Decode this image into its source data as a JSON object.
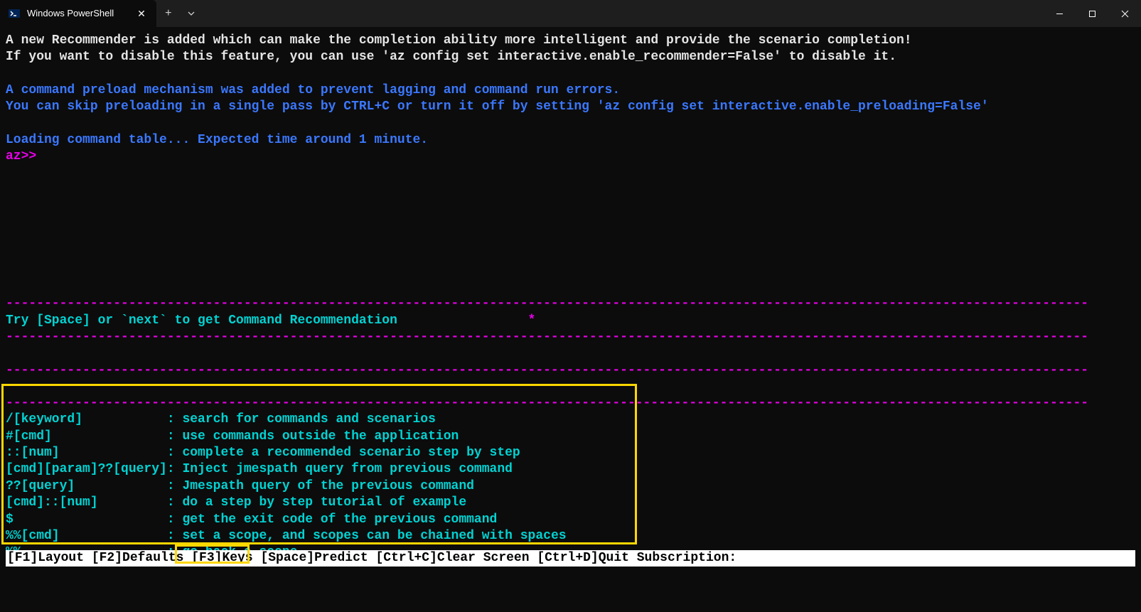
{
  "window": {
    "tab_title": "Windows PowerShell"
  },
  "terminal": {
    "line1": "A new Recommender is added which can make the completion ability more intelligent and provide the scenario completion!",
    "line2": "If you want to disable this feature, you can use 'az config set interactive.enable_recommender=False' to disable it.",
    "line3": "A command preload mechanism was added to prevent lagging and command run errors.",
    "line4": "You can skip preloading in a single pass by CTRL+C or turn it off by setting 'az config set interactive.enable_preloading=False'",
    "line5": "Loading command table... Expected time around 1 minute.",
    "prompt": "az>>",
    "rec_text": "Try [Space] or `next` to get Command Recommendation",
    "asterisk": "*",
    "dashes": "---------------------------------------------------------------------------------------------------------------------------------------------",
    "help_lines": [
      {
        "key": "/[keyword]           ",
        "sep": ": ",
        "desc": "search for commands and scenarios"
      },
      {
        "key": "#[cmd]               ",
        "sep": ": ",
        "desc": "use commands outside the application"
      },
      {
        "key": "::[num]              ",
        "sep": ": ",
        "desc": "complete a recommended scenario step by step"
      },
      {
        "key": "[cmd][param]??[query]",
        "sep": ": ",
        "desc": "Inject jmespath query from previous command"
      },
      {
        "key": "??[query]            ",
        "sep": ": ",
        "desc": "Jmespath query of the previous command"
      },
      {
        "key": "[cmd]::[num]         ",
        "sep": ": ",
        "desc": "do a step by step tutorial of example"
      },
      {
        "key": "$                    ",
        "sep": ": ",
        "desc": "get the exit code of the previous command"
      },
      {
        "key": "%%[cmd]              ",
        "sep": ": ",
        "desc": "set a scope, and scopes can be chained with spaces"
      },
      {
        "key": "%% ..                ",
        "sep": ": ",
        "desc": "go back a scope"
      }
    ],
    "bottombar": "[F1]Layout [F2]Defaults [F3]Keys [Space]Predict [Ctrl+C]Clear Screen [Ctrl+D]Quit Subscription:"
  }
}
